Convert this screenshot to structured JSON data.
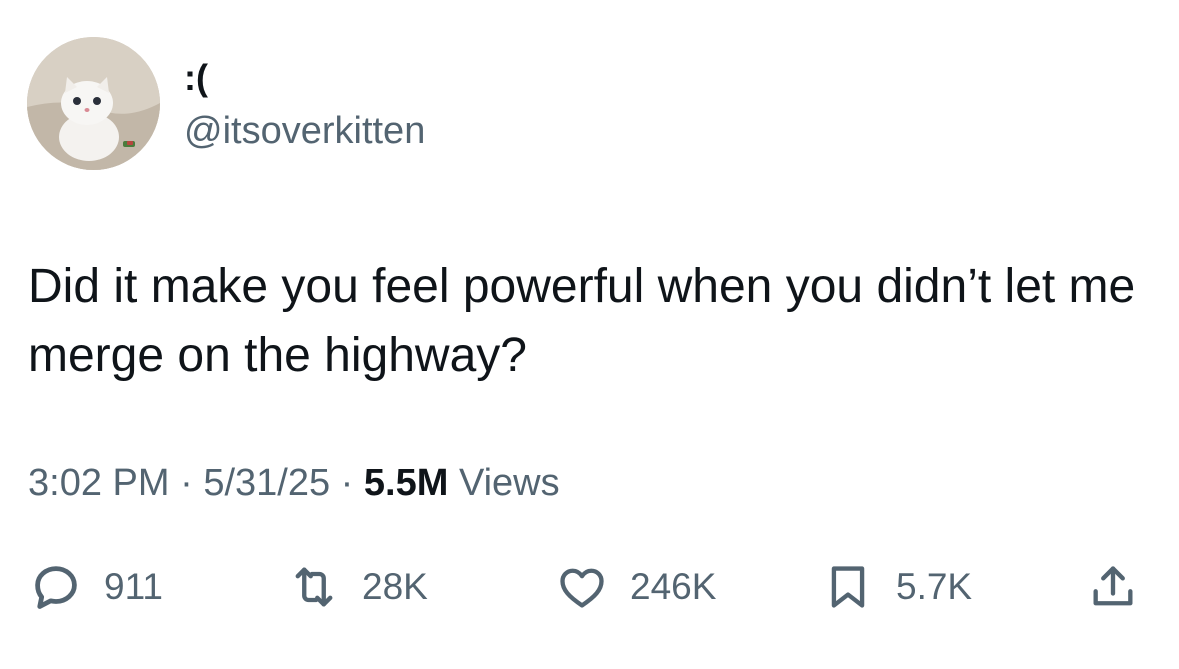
{
  "tweet": {
    "author": {
      "display_name": ":(",
      "handle": "@itsoverkitten"
    },
    "text": "Did it make you feel powerful when you didn’t let me merge on the highway?",
    "time": "3:02 PM",
    "date": "5/31/25",
    "separator": "·",
    "views_count": "5.5M",
    "views_label": "Views"
  },
  "actions": {
    "reply_count": "911",
    "retweet_count": "28K",
    "like_count": "246K",
    "bookmark_count": "5.7K"
  },
  "icons": {
    "reply": "reply-icon",
    "retweet": "retweet-icon",
    "like": "heart-icon",
    "bookmark": "bookmark-icon",
    "share": "share-icon"
  },
  "colors": {
    "text": "#0f1419",
    "secondary": "#536471",
    "background": "#ffffff"
  }
}
